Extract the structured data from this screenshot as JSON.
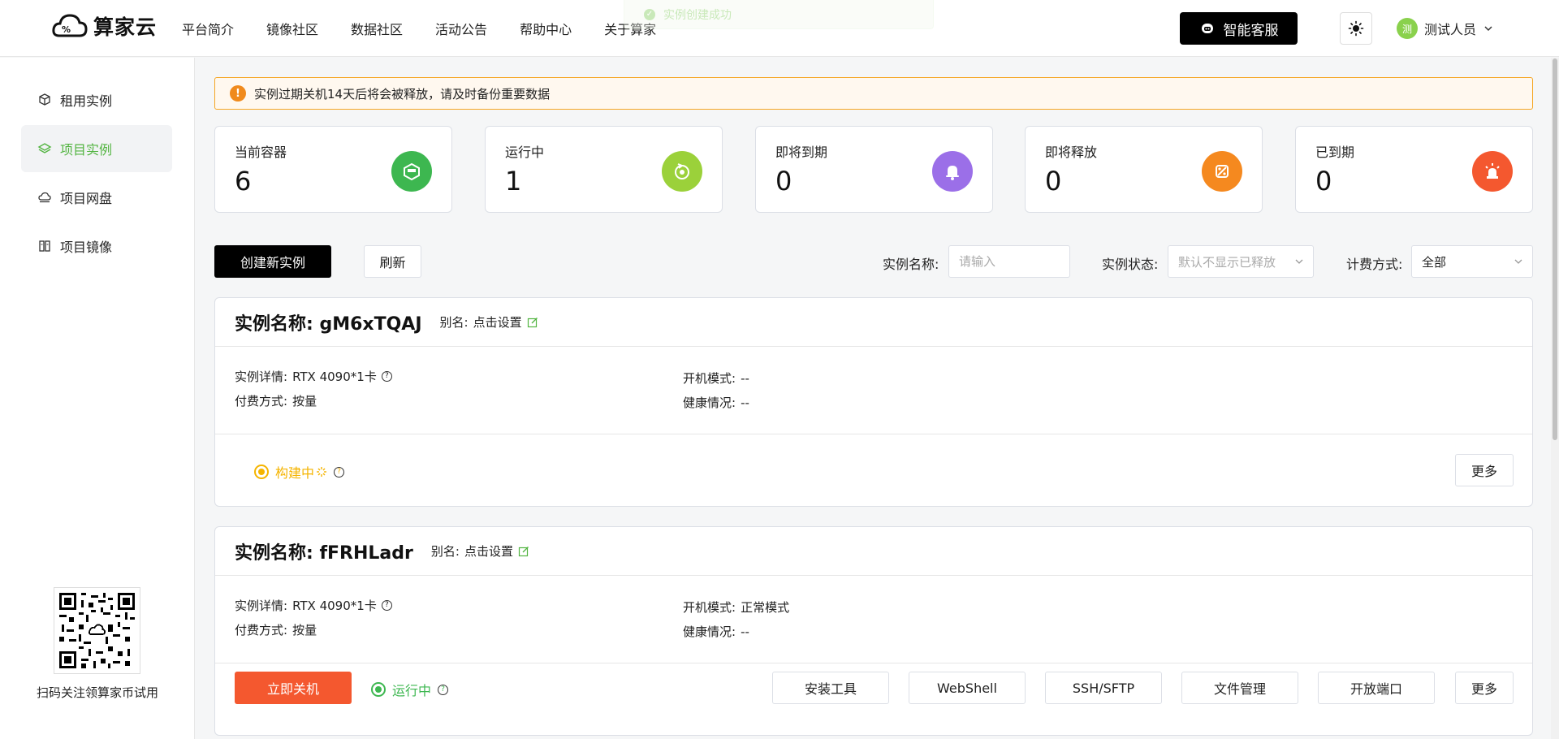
{
  "brand": {
    "name": "算家云"
  },
  "nav": [
    "平台简介",
    "镜像社区",
    "数据社区",
    "活动公告",
    "帮助中心",
    "关于算家"
  ],
  "toast": "实例创建成功",
  "header": {
    "service_label": "智能客服",
    "user_name": "测试人员",
    "avatar_initial": "测"
  },
  "sidebar": {
    "items": [
      {
        "label": "租用实例",
        "icon": "cube-icon",
        "active": false
      },
      {
        "label": "项目实例",
        "icon": "layers-icon",
        "active": true
      },
      {
        "label": "项目网盘",
        "icon": "cloud-drive-icon",
        "active": false
      },
      {
        "label": "项目镜像",
        "icon": "image-icon",
        "active": false
      }
    ],
    "qr_caption": "扫码关注领算家币试用"
  },
  "notice": "实例过期关机14天后将会被释放，请及时备份重要数据",
  "stats": [
    {
      "label": "当前容器",
      "value": "6",
      "color": "#3db750",
      "icon": "container-icon"
    },
    {
      "label": "运行中",
      "value": "1",
      "color": "#9bd13a",
      "icon": "running-icon"
    },
    {
      "label": "即将到期",
      "value": "0",
      "color": "#9b6fe8",
      "icon": "bell-icon"
    },
    {
      "label": "即将释放",
      "value": "0",
      "color": "#f5891f",
      "icon": "release-icon"
    },
    {
      "label": "已到期",
      "value": "0",
      "color": "#f4582f",
      "icon": "alarm-icon"
    }
  ],
  "toolbar": {
    "create_label": "创建新实例",
    "refresh_label": "刷新",
    "name_label": "实例名称:",
    "name_placeholder": "请输入",
    "status_label": "实例状态:",
    "status_placeholder": "默认不显示已释放",
    "billing_label": "计费方式:",
    "billing_value": "全部"
  },
  "instances": [
    {
      "title": "实例名称: gM6xTQAJ",
      "alias_label": "别名:",
      "alias_value": "点击设置",
      "detail_label": "实例详情:",
      "detail_value": "RTX 4090*1卡",
      "pay_label": "付费方式:",
      "pay_value": "按量",
      "boot_label": "开机模式:",
      "boot_value": "--",
      "health_label": "健康情况:",
      "health_value": "--",
      "status": "构建中",
      "status_color": "#f5b400",
      "more_label": "更多"
    },
    {
      "title": "实例名称: fFRHLadr",
      "alias_label": "别名:",
      "alias_value": "点击设置",
      "detail_label": "实例详情:",
      "detail_value": "RTX 4090*1卡",
      "pay_label": "付费方式:",
      "pay_value": "按量",
      "boot_label": "开机模式:",
      "boot_value": "正常模式",
      "health_label": "健康情况:",
      "health_value": "--",
      "status": "运行中",
      "status_color": "#3db750",
      "shutdown_label": "立即关机",
      "actions": [
        "安装工具",
        "WebShell",
        "SSH/SFTP",
        "文件管理",
        "开放端口"
      ],
      "more_label": "更多"
    }
  ]
}
